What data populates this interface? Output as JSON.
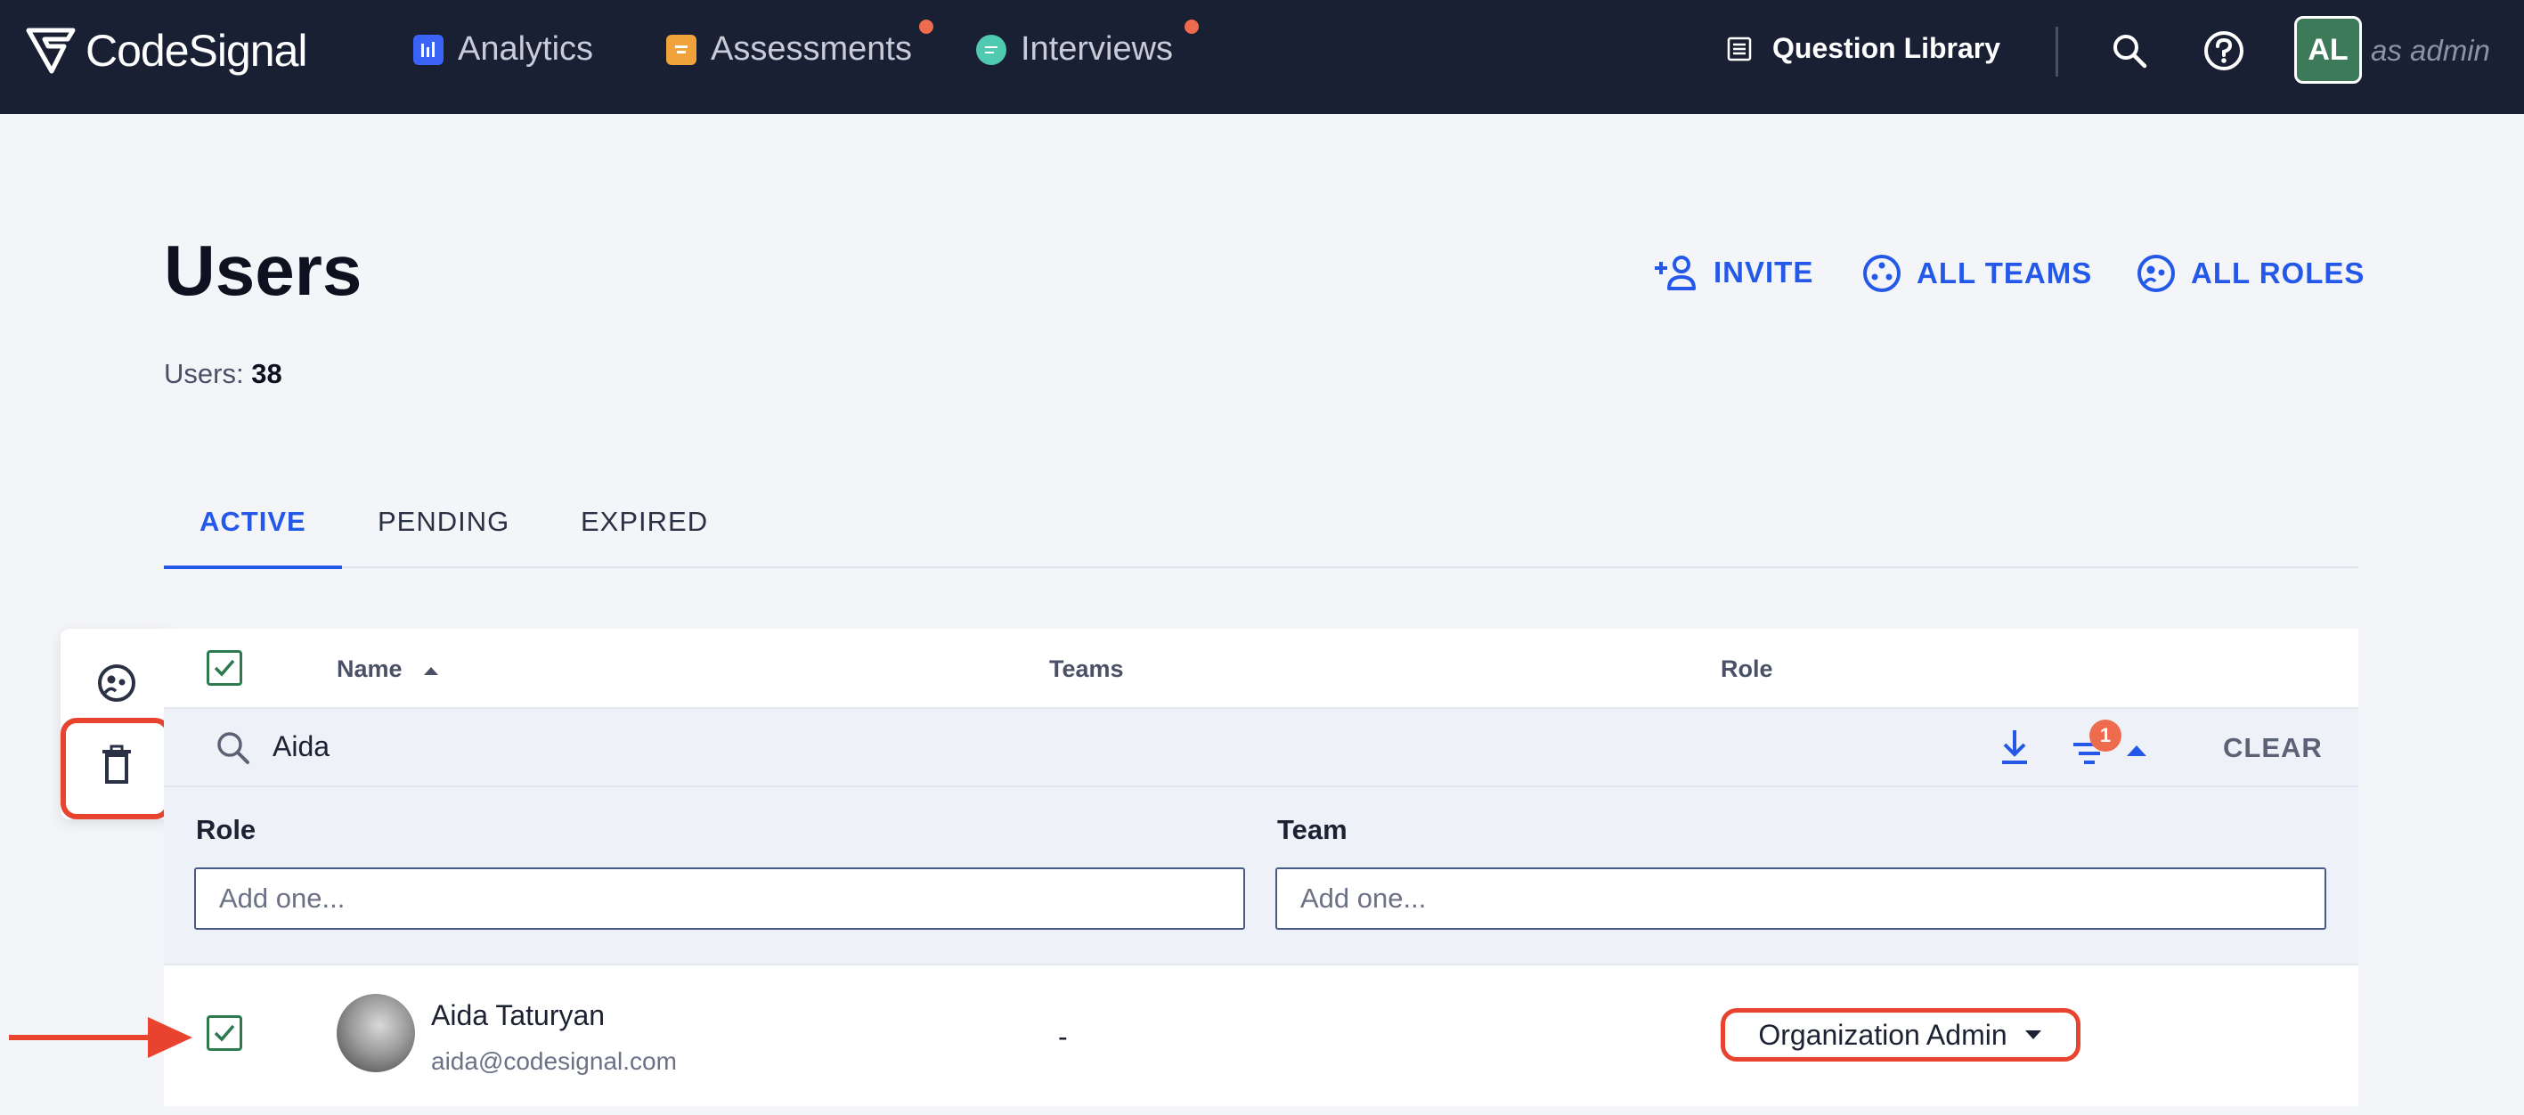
{
  "app": {
    "logo_text": "CodeSignal",
    "nav": [
      {
        "label": "Analytics",
        "icon": "analytics-icon",
        "color": "#3b63f5",
        "notification": false
      },
      {
        "label": "Assessments",
        "icon": "assessments-icon",
        "color": "#f0a33a",
        "notification": true
      },
      {
        "label": "Interviews",
        "icon": "interviews-icon",
        "color": "#4fc9b0",
        "notification": true
      }
    ],
    "question_library": "Question Library",
    "user_initials": "AL",
    "as_admin": "as admin"
  },
  "page": {
    "title": "Users",
    "users_label": "Users:",
    "users_count": "38",
    "actions": {
      "invite": "INVITE",
      "all_teams": "ALL TEAMS",
      "all_roles": "ALL ROLES"
    },
    "tabs": [
      "ACTIVE",
      "PENDING",
      "EXPIRED"
    ],
    "active_tab": "ACTIVE"
  },
  "table": {
    "columns": {
      "name": "Name",
      "teams": "Teams",
      "role": "Role"
    },
    "search_value": "Aida",
    "filter_count": "1",
    "clear_label": "CLEAR",
    "filters": {
      "role_label": "Role",
      "role_placeholder": "Add one...",
      "team_label": "Team",
      "team_placeholder": "Add one..."
    },
    "rows": [
      {
        "name": "Aida Taturyan",
        "email": "aida@codesignal.com",
        "teams": "-",
        "role": "Organization Admin",
        "selected": true
      }
    ]
  },
  "colors": {
    "nav_bg": "#1a2034",
    "accent": "#2458e8",
    "highlight": "#e8432e",
    "checkbox": "#2d7a4f",
    "notification": "#ee6c4d"
  }
}
